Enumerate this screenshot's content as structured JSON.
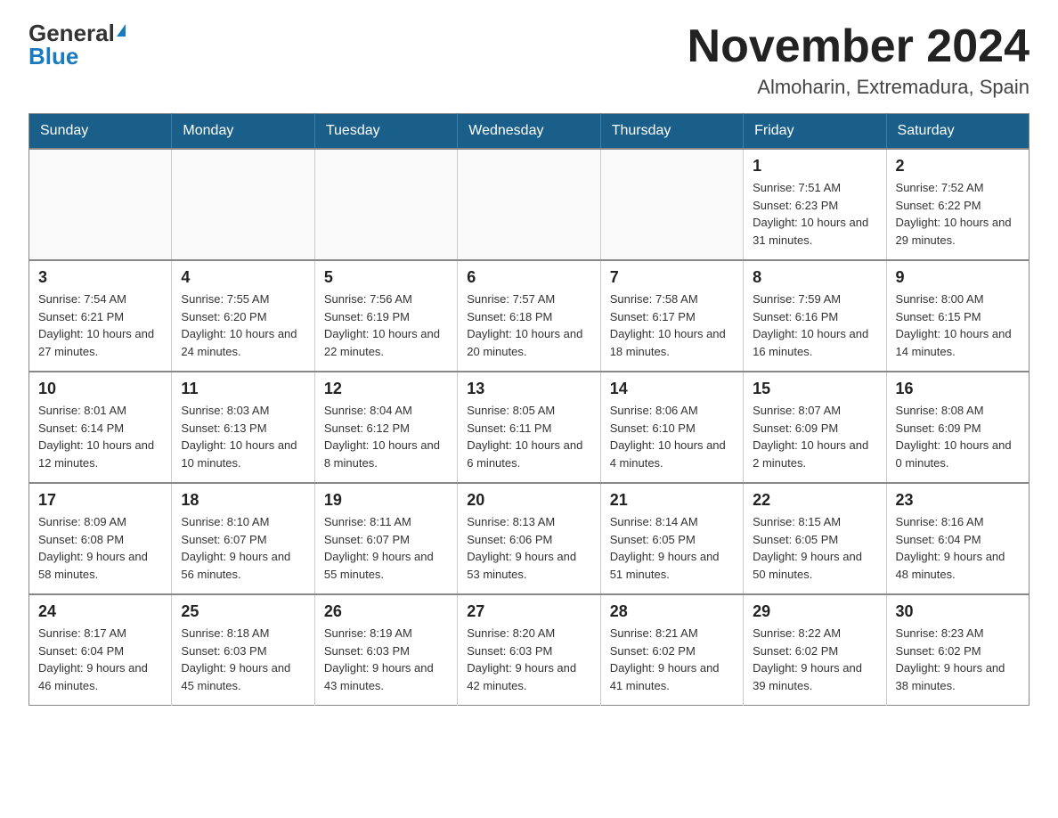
{
  "logo": {
    "general": "General",
    "blue": "Blue"
  },
  "header": {
    "month": "November 2024",
    "location": "Almoharin, Extremadura, Spain"
  },
  "weekdays": [
    "Sunday",
    "Monday",
    "Tuesday",
    "Wednesday",
    "Thursday",
    "Friday",
    "Saturday"
  ],
  "weeks": [
    [
      {
        "day": "",
        "sunrise": "",
        "sunset": "",
        "daylight": ""
      },
      {
        "day": "",
        "sunrise": "",
        "sunset": "",
        "daylight": ""
      },
      {
        "day": "",
        "sunrise": "",
        "sunset": "",
        "daylight": ""
      },
      {
        "day": "",
        "sunrise": "",
        "sunset": "",
        "daylight": ""
      },
      {
        "day": "",
        "sunrise": "",
        "sunset": "",
        "daylight": ""
      },
      {
        "day": "1",
        "sunrise": "Sunrise: 7:51 AM",
        "sunset": "Sunset: 6:23 PM",
        "daylight": "Daylight: 10 hours and 31 minutes."
      },
      {
        "day": "2",
        "sunrise": "Sunrise: 7:52 AM",
        "sunset": "Sunset: 6:22 PM",
        "daylight": "Daylight: 10 hours and 29 minutes."
      }
    ],
    [
      {
        "day": "3",
        "sunrise": "Sunrise: 7:54 AM",
        "sunset": "Sunset: 6:21 PM",
        "daylight": "Daylight: 10 hours and 27 minutes."
      },
      {
        "day": "4",
        "sunrise": "Sunrise: 7:55 AM",
        "sunset": "Sunset: 6:20 PM",
        "daylight": "Daylight: 10 hours and 24 minutes."
      },
      {
        "day": "5",
        "sunrise": "Sunrise: 7:56 AM",
        "sunset": "Sunset: 6:19 PM",
        "daylight": "Daylight: 10 hours and 22 minutes."
      },
      {
        "day": "6",
        "sunrise": "Sunrise: 7:57 AM",
        "sunset": "Sunset: 6:18 PM",
        "daylight": "Daylight: 10 hours and 20 minutes."
      },
      {
        "day": "7",
        "sunrise": "Sunrise: 7:58 AM",
        "sunset": "Sunset: 6:17 PM",
        "daylight": "Daylight: 10 hours and 18 minutes."
      },
      {
        "day": "8",
        "sunrise": "Sunrise: 7:59 AM",
        "sunset": "Sunset: 6:16 PM",
        "daylight": "Daylight: 10 hours and 16 minutes."
      },
      {
        "day": "9",
        "sunrise": "Sunrise: 8:00 AM",
        "sunset": "Sunset: 6:15 PM",
        "daylight": "Daylight: 10 hours and 14 minutes."
      }
    ],
    [
      {
        "day": "10",
        "sunrise": "Sunrise: 8:01 AM",
        "sunset": "Sunset: 6:14 PM",
        "daylight": "Daylight: 10 hours and 12 minutes."
      },
      {
        "day": "11",
        "sunrise": "Sunrise: 8:03 AM",
        "sunset": "Sunset: 6:13 PM",
        "daylight": "Daylight: 10 hours and 10 minutes."
      },
      {
        "day": "12",
        "sunrise": "Sunrise: 8:04 AM",
        "sunset": "Sunset: 6:12 PM",
        "daylight": "Daylight: 10 hours and 8 minutes."
      },
      {
        "day": "13",
        "sunrise": "Sunrise: 8:05 AM",
        "sunset": "Sunset: 6:11 PM",
        "daylight": "Daylight: 10 hours and 6 minutes."
      },
      {
        "day": "14",
        "sunrise": "Sunrise: 8:06 AM",
        "sunset": "Sunset: 6:10 PM",
        "daylight": "Daylight: 10 hours and 4 minutes."
      },
      {
        "day": "15",
        "sunrise": "Sunrise: 8:07 AM",
        "sunset": "Sunset: 6:09 PM",
        "daylight": "Daylight: 10 hours and 2 minutes."
      },
      {
        "day": "16",
        "sunrise": "Sunrise: 8:08 AM",
        "sunset": "Sunset: 6:09 PM",
        "daylight": "Daylight: 10 hours and 0 minutes."
      }
    ],
    [
      {
        "day": "17",
        "sunrise": "Sunrise: 8:09 AM",
        "sunset": "Sunset: 6:08 PM",
        "daylight": "Daylight: 9 hours and 58 minutes."
      },
      {
        "day": "18",
        "sunrise": "Sunrise: 8:10 AM",
        "sunset": "Sunset: 6:07 PM",
        "daylight": "Daylight: 9 hours and 56 minutes."
      },
      {
        "day": "19",
        "sunrise": "Sunrise: 8:11 AM",
        "sunset": "Sunset: 6:07 PM",
        "daylight": "Daylight: 9 hours and 55 minutes."
      },
      {
        "day": "20",
        "sunrise": "Sunrise: 8:13 AM",
        "sunset": "Sunset: 6:06 PM",
        "daylight": "Daylight: 9 hours and 53 minutes."
      },
      {
        "day": "21",
        "sunrise": "Sunrise: 8:14 AM",
        "sunset": "Sunset: 6:05 PM",
        "daylight": "Daylight: 9 hours and 51 minutes."
      },
      {
        "day": "22",
        "sunrise": "Sunrise: 8:15 AM",
        "sunset": "Sunset: 6:05 PM",
        "daylight": "Daylight: 9 hours and 50 minutes."
      },
      {
        "day": "23",
        "sunrise": "Sunrise: 8:16 AM",
        "sunset": "Sunset: 6:04 PM",
        "daylight": "Daylight: 9 hours and 48 minutes."
      }
    ],
    [
      {
        "day": "24",
        "sunrise": "Sunrise: 8:17 AM",
        "sunset": "Sunset: 6:04 PM",
        "daylight": "Daylight: 9 hours and 46 minutes."
      },
      {
        "day": "25",
        "sunrise": "Sunrise: 8:18 AM",
        "sunset": "Sunset: 6:03 PM",
        "daylight": "Daylight: 9 hours and 45 minutes."
      },
      {
        "day": "26",
        "sunrise": "Sunrise: 8:19 AM",
        "sunset": "Sunset: 6:03 PM",
        "daylight": "Daylight: 9 hours and 43 minutes."
      },
      {
        "day": "27",
        "sunrise": "Sunrise: 8:20 AM",
        "sunset": "Sunset: 6:03 PM",
        "daylight": "Daylight: 9 hours and 42 minutes."
      },
      {
        "day": "28",
        "sunrise": "Sunrise: 8:21 AM",
        "sunset": "Sunset: 6:02 PM",
        "daylight": "Daylight: 9 hours and 41 minutes."
      },
      {
        "day": "29",
        "sunrise": "Sunrise: 8:22 AM",
        "sunset": "Sunset: 6:02 PM",
        "daylight": "Daylight: 9 hours and 39 minutes."
      },
      {
        "day": "30",
        "sunrise": "Sunrise: 8:23 AM",
        "sunset": "Sunset: 6:02 PM",
        "daylight": "Daylight: 9 hours and 38 minutes."
      }
    ]
  ]
}
